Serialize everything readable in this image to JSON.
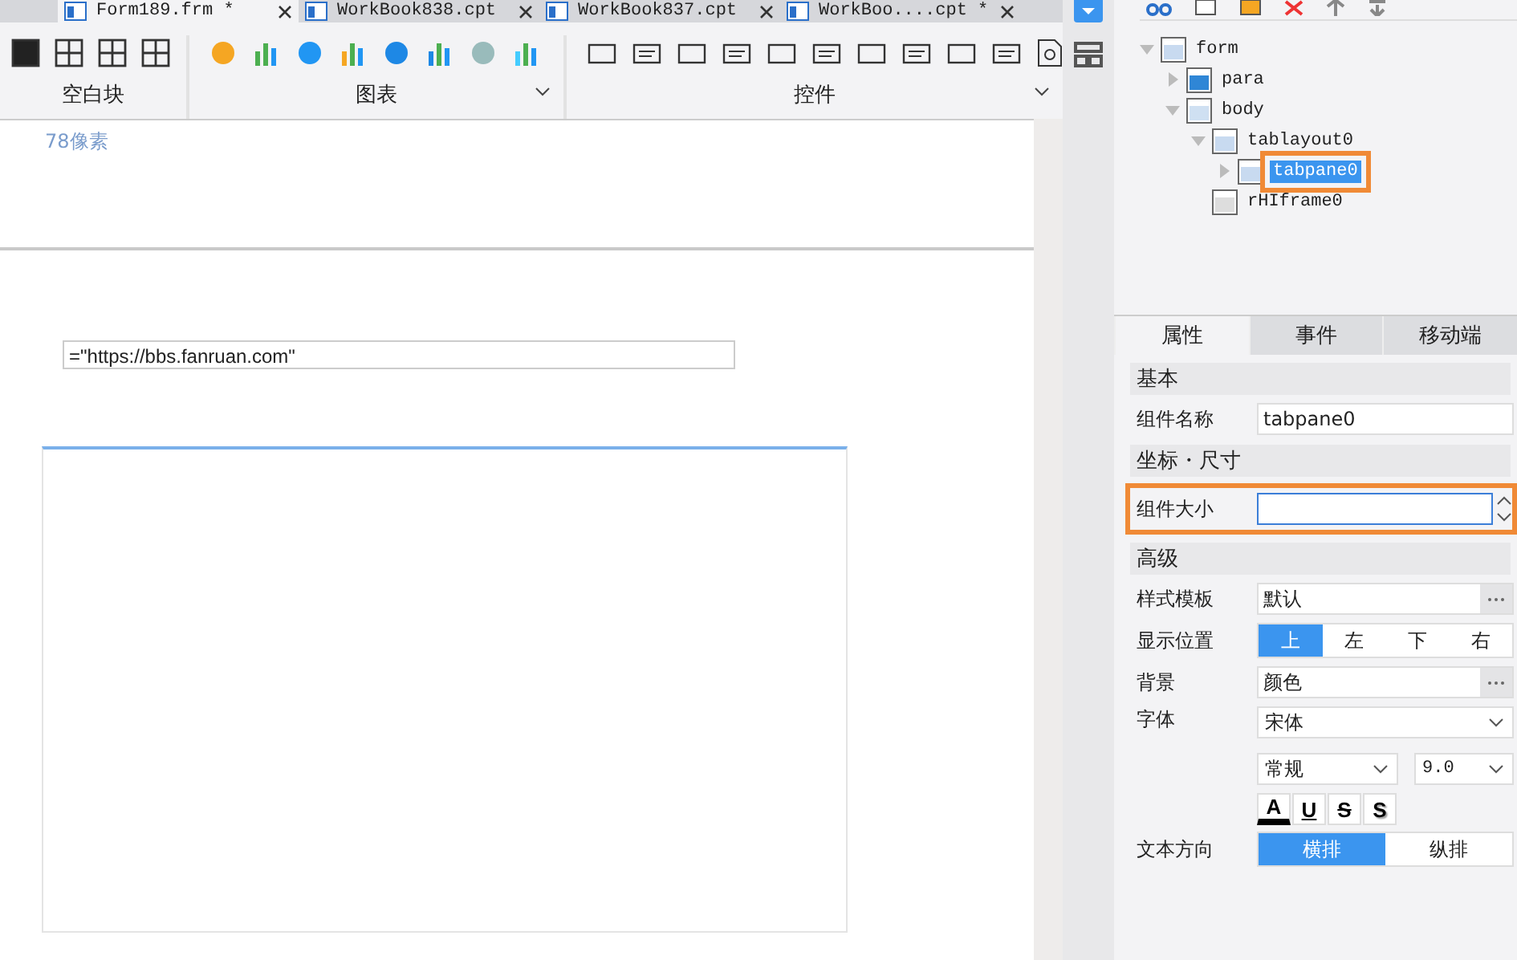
{
  "doc_tabs": [
    {
      "label": "Form189.frm *",
      "selected": true
    },
    {
      "label": "WorkBook838.cpt",
      "selected": false
    },
    {
      "label": "WorkBook837.cpt",
      "selected": false
    },
    {
      "label": "WorkBoo....cpt *",
      "selected": false
    }
  ],
  "toolbar_groups": [
    {
      "label": "空白块",
      "kind": "layout",
      "expandable": false
    },
    {
      "label": "图表",
      "kind": "chart",
      "expandable": true
    },
    {
      "label": "控件",
      "kind": "widget",
      "expandable": true
    }
  ],
  "canvas": {
    "ruler_label": "78像素",
    "formula_field": {
      "value": "=\"https://bbs.fanruan.com\""
    }
  },
  "tree": [
    {
      "label": "form",
      "kind": "form",
      "expanded": true,
      "selected": false,
      "children": [
        {
          "label": "para",
          "kind": "para",
          "expanded": false,
          "selected": false
        },
        {
          "label": "body",
          "kind": "body",
          "expanded": true,
          "selected": false,
          "children": [
            {
              "label": "tablayout0",
              "kind": "tablayout",
              "expanded": true,
              "selected": false,
              "children": [
                {
                  "label": "tabpane0",
                  "kind": "tabpane",
                  "expanded": false,
                  "selected": true
                }
              ]
            },
            {
              "label": "rHIframe0",
              "kind": "iframe",
              "selected": false
            }
          ]
        }
      ]
    }
  ],
  "prop_tabs": [
    {
      "label": "属性",
      "selected": true
    },
    {
      "label": "事件",
      "selected": false
    },
    {
      "label": "移动端",
      "selected": false
    }
  ],
  "prop_rows": [
    {
      "kind": "section",
      "label": "基本"
    },
    {
      "kind": "text",
      "label": "组件名称",
      "value": "tabpane0"
    },
    {
      "kind": "section",
      "label": "坐标・尺寸"
    },
    {
      "kind": "spinner",
      "label": "组件大小",
      "highlighted": true
    },
    {
      "kind": "section",
      "label": "高级"
    },
    {
      "kind": "dots",
      "label": "样式模板",
      "value": "默认"
    },
    {
      "kind": "segmented",
      "label": "显示位置",
      "options": [
        {
          "label": "上",
          "selected": true
        },
        {
          "label": "左",
          "selected": false
        },
        {
          "label": "下",
          "selected": false
        },
        {
          "label": "右",
          "selected": false
        }
      ]
    },
    {
      "kind": "dots",
      "label": "背景",
      "value": "颜色"
    },
    {
      "kind": "font",
      "label": "字体",
      "family": "宋体",
      "style": "常规",
      "size": "9.0",
      "buttons": [
        {
          "label": "A",
          "kind": "color"
        },
        {
          "label": "U",
          "kind": "underline"
        },
        {
          "label": "S",
          "kind": "strike"
        },
        {
          "label": "S",
          "kind": "shadow"
        }
      ]
    },
    {
      "kind": "segmented",
      "label": "文本方向",
      "options": [
        {
          "label": "横排",
          "selected": true
        },
        {
          "label": "纵排",
          "selected": false
        }
      ]
    }
  ]
}
